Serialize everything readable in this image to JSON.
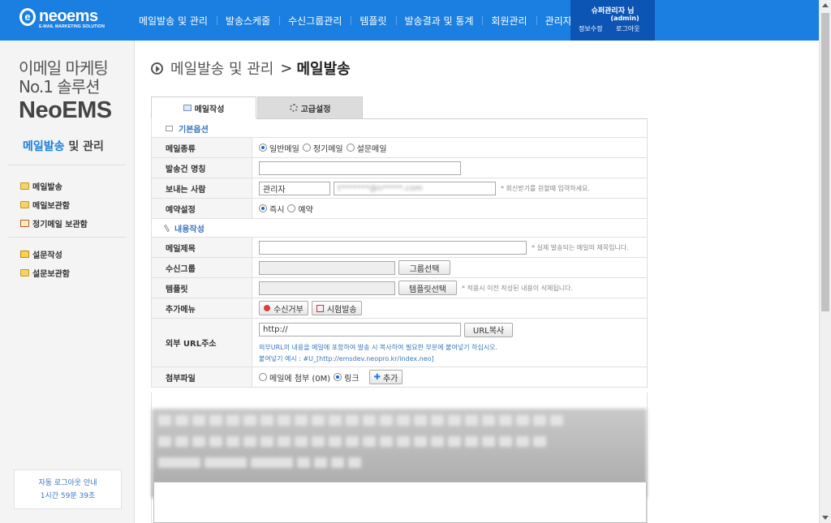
{
  "header": {
    "logo_mark": "e",
    "logo_name": "neoems",
    "logo_tagline": "E-MAIL MARKETING SOLUTION",
    "nav": [
      "메일발송 및 관리",
      "발송스케줄",
      "수신그룹관리",
      "템플릿",
      "발송결과 및 통계",
      "회원관리",
      "관리자"
    ],
    "user_name": "슈퍼관리자 님",
    "user_id": "(admin)",
    "profile_link": "정보수정",
    "logout_link": "로그아웃"
  },
  "sidebar": {
    "headline1": "이메일 마케팅",
    "headline2": "No.1 솔루션",
    "headline3": "NeoEMS",
    "section_highlight": "메일발송",
    "section_rest": " 및 관리",
    "menu": [
      "메일발송",
      "메일보관함",
      "정기메일 보관함",
      "설문작성",
      "설문보관함"
    ],
    "auto_logout_title": "자동 로그아웃 안내",
    "auto_logout_time": "1시간 59분 39초"
  },
  "breadcrumb": {
    "parent": "메일발송 및 관리",
    "sep": ">",
    "current": "메일발송"
  },
  "tabs": {
    "compose": "메일작성",
    "advanced": "고급설정"
  },
  "form": {
    "basic_section": "기본옵션",
    "mail_type_label": "메일종류",
    "mail_types": [
      "일반메일",
      "정기메일",
      "설문메일"
    ],
    "mail_type_selected": 0,
    "send_name_label": "발송건 명칭",
    "send_name_value": "",
    "sender_label": "보내는 사람",
    "sender_name": "관리자",
    "sender_email": "t*******@n*****.com",
    "sender_hint": "* 회신받기를 원할때 입력하세요.",
    "schedule_label": "예약설정",
    "schedule_options": [
      "즉시",
      "예약"
    ],
    "schedule_selected": 0,
    "content_section": "내용작성",
    "subject_label": "메일제목",
    "subject_hint": "* 실제 발송되는 메일의 제목입니다.",
    "group_label": "수신그룹",
    "group_button": "그룹선택",
    "template_label": "템플릿",
    "template_button": "템플릿선택",
    "template_hint": "* 적용시 이전 작성된 내용이 삭제됩니다.",
    "extra_label": "추가메뉴",
    "unsubscribe_button": "수신거부",
    "test_send_button": "시험발송",
    "url_label": "외부 URL주소",
    "url_value": "http://",
    "url_copy_button": "URL복사",
    "url_hint1": "외부URL의 내용을 메일에 포함하여 발송 시 복사하여 필요한 부분에 붙여넣기 하십시오.",
    "url_hint2": "붙여넣기 예시 : #U_[http://emsdev.neopro.kr/index.neo]",
    "attach_label": "첨부파일",
    "attach_options": [
      "메일에 첨부 (0M)",
      "링크"
    ],
    "attach_selected": 1,
    "add_button": "추가"
  },
  "colors": {
    "brand_blue": "#1a7fe0",
    "user_box": "#0d55b5",
    "accent_text": "#3a76c2"
  }
}
